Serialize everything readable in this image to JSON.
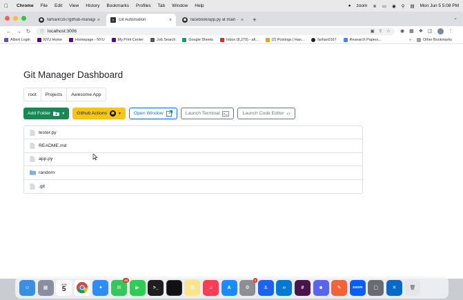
{
  "menubar": {
    "app": "Chrome",
    "items": [
      "File",
      "Edit",
      "View",
      "History",
      "Bookmarks",
      "Profiles",
      "Tab",
      "Window",
      "Help"
    ],
    "zoom_label": "zoom",
    "datetime": "Mon Jun 5  5:08 PM"
  },
  "tabs": [
    {
      "label": "farhan0167/github-manager: A"
    },
    {
      "label": "Git Automation"
    },
    {
      "label": "facebook/app.py at main · farh"
    }
  ],
  "address": {
    "url": "localhost:3006"
  },
  "bookmarks": [
    {
      "label": "Albert Login",
      "color": "#6b4ea0"
    },
    {
      "label": "NYU Home",
      "color": "#57068c"
    },
    {
      "label": "Homepage - NYU",
      "color": "#57068c"
    },
    {
      "label": "My Print Center",
      "color": "#57068c"
    },
    {
      "label": "Job Search",
      "color": "#555555"
    },
    {
      "label": "Google Sheets",
      "color": "#0f9d58"
    },
    {
      "label": "Inbox (8,279) - afi...",
      "color": "#d93025"
    },
    {
      "label": "(2) Postings | Han...",
      "color": "#e8a600"
    },
    {
      "label": "farhan0167",
      "color": "#222222"
    },
    {
      "label": "Research Papers...",
      "color": "#4285f4"
    }
  ],
  "bookmarks_other": "Other Bookmarks",
  "page": {
    "title": "Git Manager Dashboard",
    "breadcrumbs": [
      "root",
      "Projects",
      "Awesome App"
    ],
    "buttons": {
      "add_folder": "Add Folder",
      "github_actions": "Github Actions",
      "open_window": "Open Window",
      "launch_terminal": "Launch Terminal",
      "launch_code_editor": "Launch Code Editor"
    },
    "files": [
      {
        "name": "tester.py",
        "kind": "file"
      },
      {
        "name": "README.md",
        "kind": "file"
      },
      {
        "name": "app.py",
        "kind": "file"
      },
      {
        "name": "random",
        "kind": "folder"
      },
      {
        "name": ".git",
        "kind": "file"
      }
    ]
  },
  "dock": {
    "calendar_month": "JUN",
    "calendar_day": "5",
    "messages_badge": "44",
    "settings_badge": "1",
    "zoom_label": "zoom"
  },
  "colors": {
    "green": "#198754",
    "yellow": "#f5c518",
    "blue": "#0d6efd",
    "gray": "#6c757d"
  }
}
